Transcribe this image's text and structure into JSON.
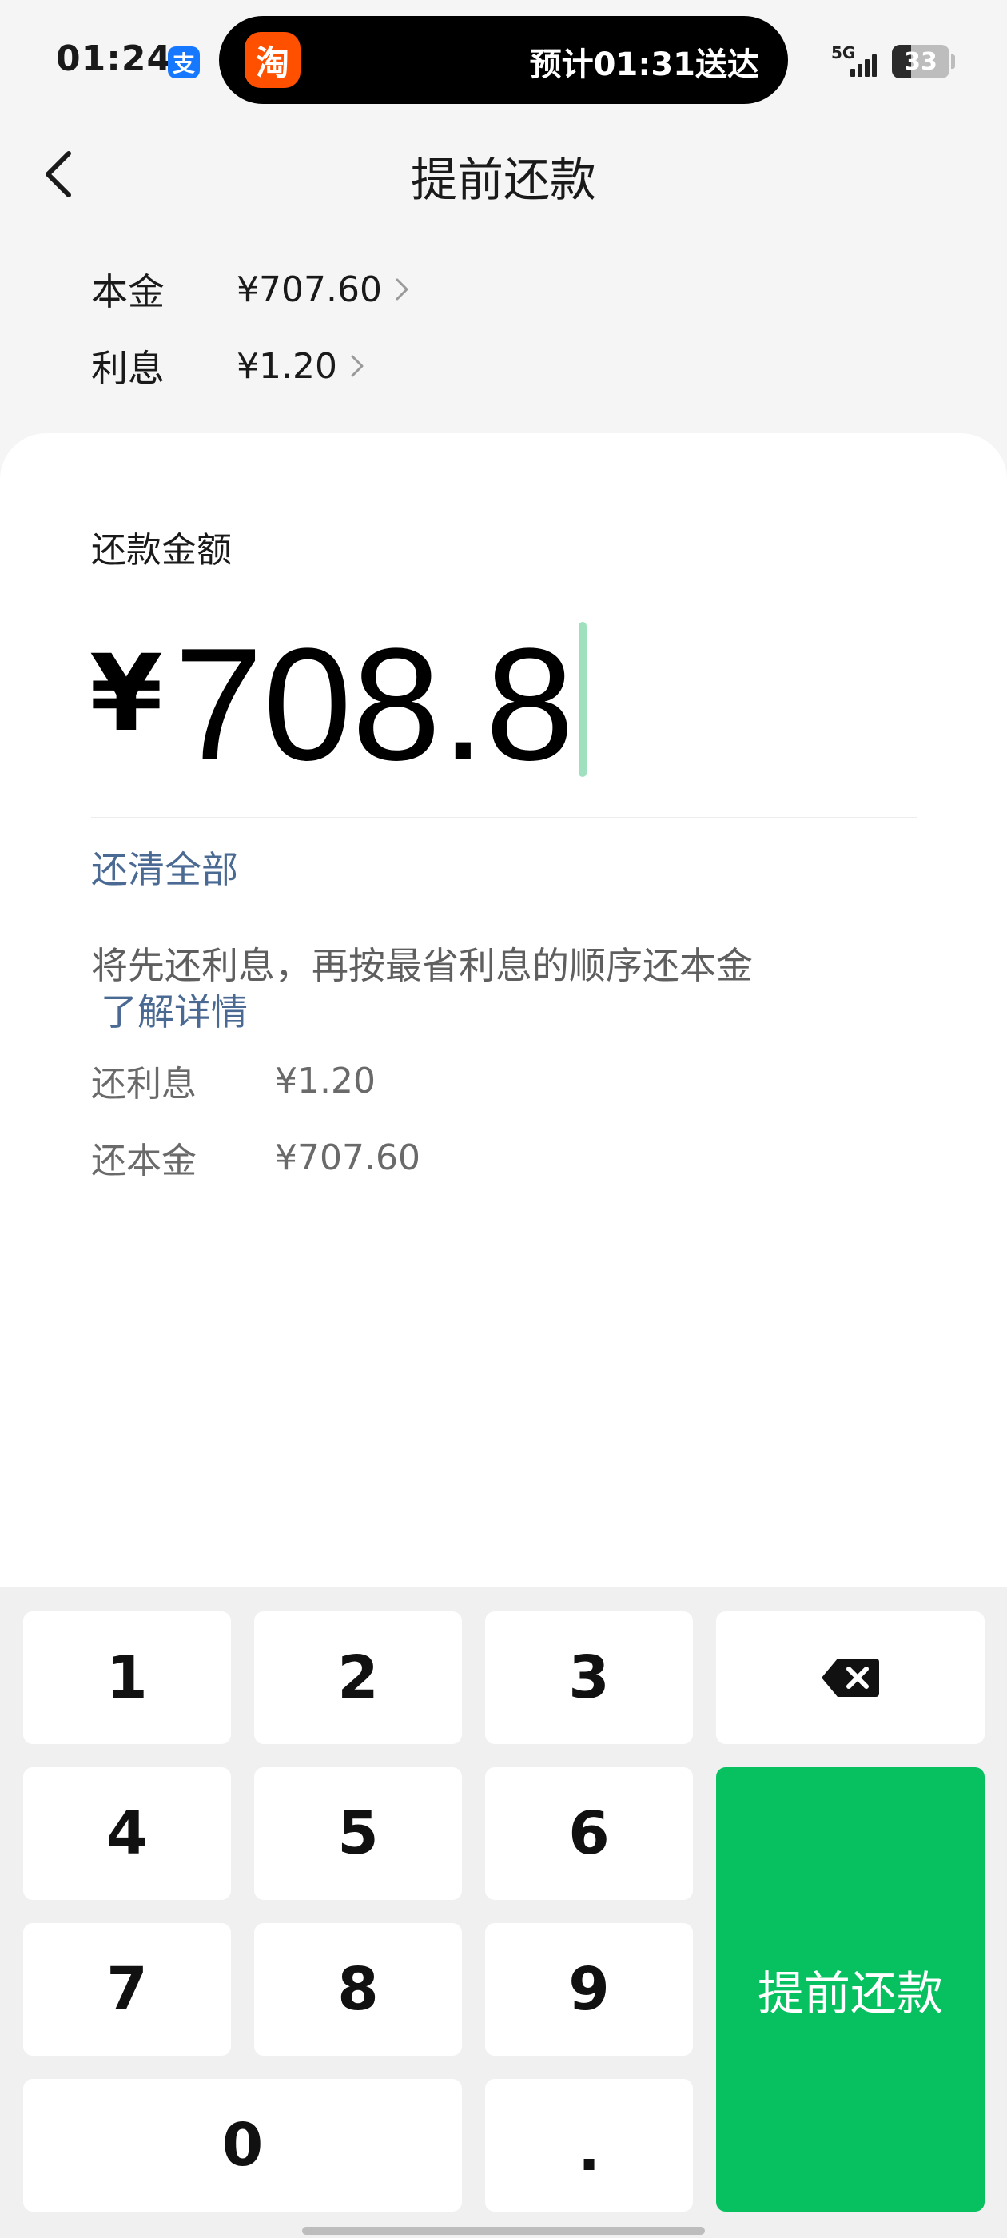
{
  "status_bar": {
    "time": "01:24",
    "alipay_badge": "支",
    "island_app_glyph": "淘",
    "island_text": "预计01:31送达",
    "network": "5G",
    "battery": "33",
    "battery_level_percent": 33
  },
  "nav": {
    "title": "提前还款",
    "back_icon": "chevron-left-icon"
  },
  "summary": {
    "principal_label": "本金",
    "principal_value": "¥707.60",
    "interest_label": "利息",
    "interest_value": "¥1.20"
  },
  "amount": {
    "label": "还款金额",
    "currency": "¥",
    "value": "708.8",
    "pay_all": "还清全部"
  },
  "info": {
    "tip": "将先还利息，再按最省利息的顺序还本金",
    "learn_more": "了解详情",
    "repay_interest_label": "还利息",
    "repay_interest_value": "¥1.20",
    "repay_principal_label": "还本金",
    "repay_principal_value": "¥707.60"
  },
  "keypad": {
    "k1": "1",
    "k2": "2",
    "k3": "3",
    "k4": "4",
    "k5": "5",
    "k6": "6",
    "k7": "7",
    "k8": "8",
    "k9": "9",
    "k0": "0",
    "dot": ".",
    "backspace_icon": "backspace-icon",
    "confirm": "提前还款"
  },
  "colors": {
    "brand_green": "#07c160",
    "link_blue": "#4a6a94",
    "caret": "#9fe0be",
    "taobao_orange": "#ff5000",
    "alipay_blue": "#1677ff"
  }
}
